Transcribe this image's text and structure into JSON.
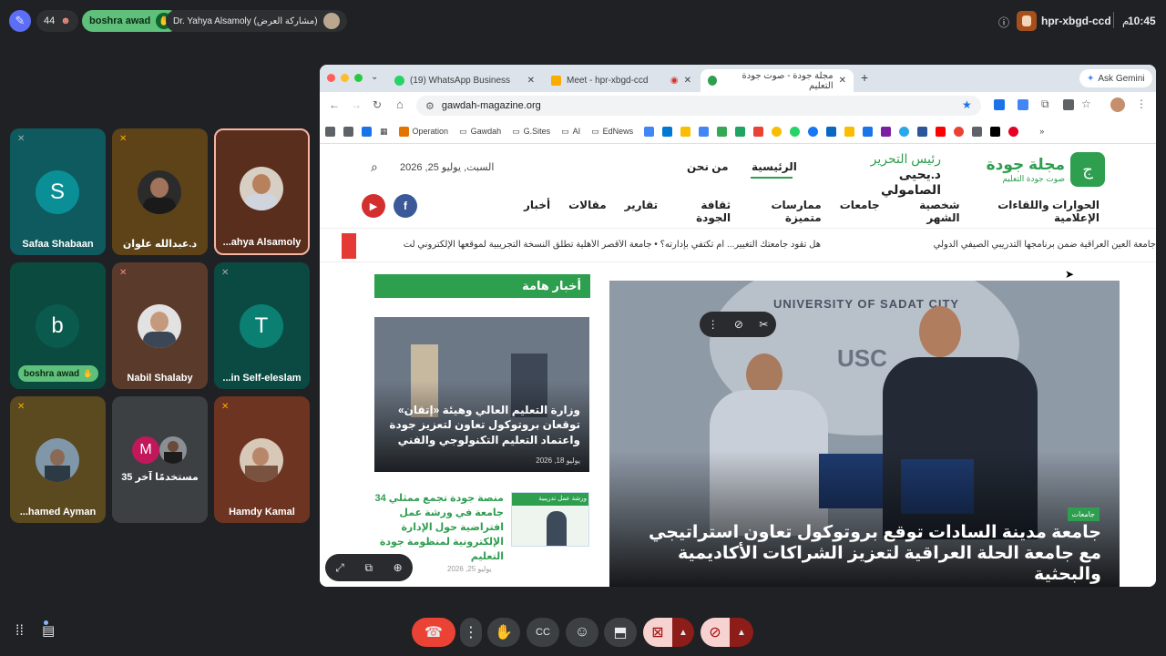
{
  "topbar": {
    "count": "44",
    "presenter_name": "boshra awad",
    "presenting_label": "Dr. Yahya Alsamoly (مشاركة العرض)",
    "meeting_code": "hpr-xbgd-ccd",
    "time": "10:45",
    "time_suffix": "م"
  },
  "tiles": [
    {
      "name": "Safaa Shabaan",
      "letter": "S",
      "color": "#0e7d83"
    },
    {
      "name": "د.عبدالله علوان",
      "letter": "",
      "color": "#6b4c22"
    },
    {
      "name": "...ahya Alsamoly",
      "letter": "",
      "color": "#5a2e1d"
    },
    {
      "name": "boshra awad",
      "letter": "b",
      "color": "#0b4a3f"
    },
    {
      "name": "Nabil Shalaby",
      "letter": "",
      "color": "#5a3a2a"
    },
    {
      "name": "...in Self-eleslam",
      "letter": "T",
      "color": "#0b6b62"
    },
    {
      "name": "...hamed Ayman",
      "letter": "",
      "color": "#5b4a20"
    },
    {
      "name": "35 مستخدمًا آخر",
      "letter": "M",
      "color": "#3c4043"
    },
    {
      "name": "Hamdy Kamal",
      "letter": "",
      "color": "#6e3422"
    }
  ],
  "browser": {
    "tabs": [
      {
        "label": "(19) WhatsApp Business"
      },
      {
        "label": "Meet - hpr-xbgd-ccd"
      },
      {
        "label": "مجلة جودة - صوت جودة التعليم"
      }
    ],
    "ask_gemini": "Ask Gemini",
    "url": "gawdah-magazine.org",
    "bookmarks": [
      "Operation",
      "Gawdah",
      "G.Sites",
      "AI",
      "EdNews"
    ]
  },
  "site": {
    "logo_title": "مجلة جودة",
    "logo_sub": "صوت جودة التعليم",
    "editor_label": "رئيس التحرير",
    "editor_name": "د.يحيى الصامولي",
    "nav_home": "الرئيسية",
    "nav_about": "من نحن",
    "date": "السبت, يوليو 25, 2026",
    "menu": [
      "أخبار",
      "مقالات",
      "تقارير",
      "ثقافة الجودة",
      "ممارسات متميزة",
      "جامعات",
      "شخصية الشهر",
      "الحوارات واللقاءات الإعلامية"
    ],
    "ticker": "هل تقود جامعتك التغيير... أم تكتفي بإدارته؟   •   جامعة الأقصر الأهلية تطلق النسخة التجريبية لموقعها الإلكتروني لت",
    "ticker_right": "جامعة العين العراقية ضمن برنامجها التدريبي الصيفي الدولي",
    "important_news": "أخبار هامة",
    "news1": "وزارة التعليم العالي وهيئة «إتقان» توقعان بروتوكول تعاون لتعزيز جودة واعتماد التعليم التكنولوجي والفني",
    "news1_date": "يوليو 18, 2026",
    "news2": "منصة جودة تجمع ممثلي 34 جامعة في ورشة عمل افتراضية حول الإدارة الإلكترونية لمنظومة جودة التعليم",
    "news2_date": "يوليو 25, 2026",
    "main_badge": "جامعات",
    "main_headline": "جامعة مدينة السادات توقع بروتوكول تعاون استراتيجي مع جامعة الحلة العراقية لتعزيز الشراكات الأكاديمية والبحثية",
    "banner_text": "UNIVERSITY OF SADAT CITY",
    "banner_sub": "USC",
    "workshop_label": "ورشة عمل تدريبية"
  },
  "colors": {
    "accent_green": "#2e9e4f",
    "end_call": "#ea4335",
    "meet_green": "#5ec07a"
  }
}
